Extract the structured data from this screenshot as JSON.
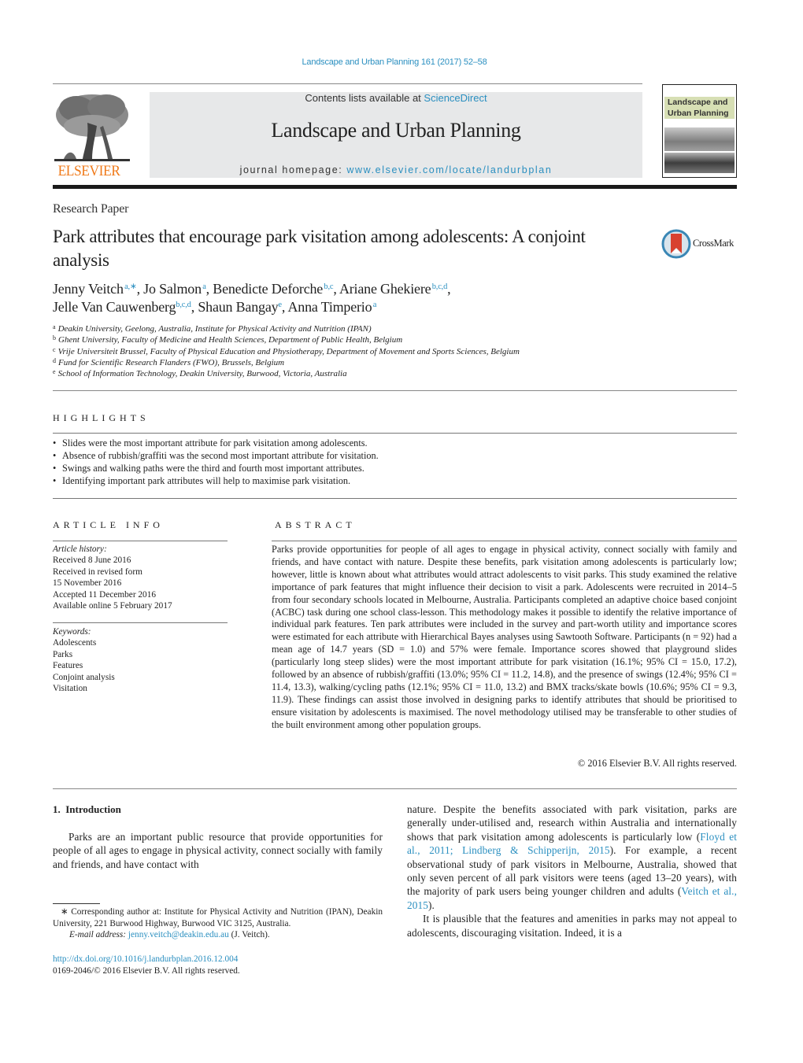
{
  "journal_ref": "Landscape and Urban Planning 161 (2017) 52–58",
  "masthead": {
    "publisher": "ELSEVIER",
    "contents_prefix": "Contents lists available at ",
    "contents_link": "ScienceDirect",
    "journal_title": "Landscape and Urban Planning",
    "homepage_prefix": "journal homepage: ",
    "homepage_url": "www.elsevier.com/locate/landurbplan",
    "cover_title": "Landscape and Urban Planning"
  },
  "article": {
    "type": "Research Paper",
    "title": "Park attributes that encourage park visitation among adolescents: A conjoint analysis",
    "crossmark_label": "CrossMark",
    "authors": [
      {
        "name": "Jenny Veitch",
        "sup": "a,∗",
        "sep": ", "
      },
      {
        "name": "Jo Salmon",
        "sup": "a",
        "sep": ", "
      },
      {
        "name": "Benedicte Deforche",
        "sup": "b,c",
        "sep": ", "
      },
      {
        "name": "Ariane Ghekiere",
        "sup": "b,c,d",
        "sep": ","
      },
      {
        "name": "Jelle Van Cauwenberg",
        "sup": "b,c,d",
        "sep": ", "
      },
      {
        "name": "Shaun Bangay",
        "sup": "e",
        "sep": ", "
      },
      {
        "name": "Anna Timperio",
        "sup": "a",
        "sep": ""
      }
    ],
    "affiliations": [
      {
        "key": "a",
        "text": "Deakin University, Geelong, Australia, Institute for Physical Activity and Nutrition (IPAN)"
      },
      {
        "key": "b",
        "text": "Ghent University, Faculty of Medicine and Health Sciences, Department of Public Health, Belgium"
      },
      {
        "key": "c",
        "text": "Vrije Universiteit Brussel, Faculty of Physical Education and Physiotherapy, Department of Movement and Sports Sciences, Belgium"
      },
      {
        "key": "d",
        "text": "Fund for Scientific Research Flanders (FWO), Brussels, Belgium"
      },
      {
        "key": "e",
        "text": "School of Information Technology, Deakin University, Burwood, Victoria, Australia"
      }
    ]
  },
  "highlights": {
    "heading": "HIGHLIGHTS",
    "items": [
      "Slides were the most important attribute for park visitation among adolescents.",
      "Absence of rubbish/graffiti was the second most important attribute for visitation.",
      "Swings and walking paths were the third and fourth most important attributes.",
      "Identifying important park attributes will help to maximise park visitation."
    ]
  },
  "article_info": {
    "heading": "ARTICLE INFO",
    "history_label": "Article history:",
    "history": [
      "Received 8 June 2016",
      "Received in revised form",
      "15 November 2016",
      "Accepted 11 December 2016",
      "Available online 5 February 2017"
    ],
    "keywords_label": "Keywords:",
    "keywords": [
      "Adolescents",
      "Parks",
      "Features",
      "Conjoint analysis",
      "Visitation"
    ]
  },
  "abstract": {
    "heading": "ABSTRACT",
    "text": "Parks provide opportunities for people of all ages to engage in physical activity, connect socially with family and friends, and have contact with nature. Despite these benefits, park visitation among ado­lescents is particularly low; however, little is known about what attributes would attract adolescents to visit parks. This study examined the relative importance of park features that might influence their decision to visit a park. Adolescents were recruited in 2014–5 from four secondary schools located in Melbourne, Australia. Participants completed an adaptive choice based conjoint (ACBC) task during one school class-lesson. This methodology makes it possible to identify the relative importance of individual park features. Ten park attributes were included in the survey and part-worth utility and importance scores were estimated for each attribute with Hierarchical Bayes analyses using Sawtooth Software. Par­ticipants (n = 92) had a mean age of 14.7 years (SD = 1.0) and 57% were female. Importance scores showed that playground slides (particularly long steep slides) were the most important attribute for park visita­tion (16.1%; 95% CI = 15.0, 17.2), followed by an absence of rubbish/graffiti (13.0%; 95% CI = 11.2, 14.8), and the presence of swings (12.4%; 95% CI = 11.4, 13.3), walking/cycling paths (12.1%; 95% CI = 11.0, 13.2) and BMX tracks/skate bowls (10.6%; 95% CI = 9.3, 11.9). These findings can assist those involved in designing parks to identify attributes that should be prioritised to ensure visitation by adolescents is maximised. The novel methodology utilised may be transferable to other studies of the built environment among other population groups.",
    "copyright": "© 2016 Elsevier B.V. All rights reserved."
  },
  "introduction": {
    "heading": "1.  Introduction",
    "col1_para1": "Parks are an important public resource that provide oppor­tunities for people of all ages to engage in physical activity, connect socially with family and friends, and have contact with",
    "col2_para1_a": "nature. Despite the benefits associated with park visitation, parks are generally under-utilised and, research within Australia and internationally shows that park visitation among adolescents is particularly low (",
    "col2_cite1": "Floyd et al., 2011; Lindberg & Schipperijn, 2015",
    "col2_para1_b": "). For example, a recent observational study of park visitors in Mel­bourne, Australia, showed that only seven percent of all park visitors were teens (aged 13–20 years), with the majority of park users being younger children and adults (",
    "col2_cite2": "Veitch et al., 2015",
    "col2_para1_c": ").",
    "col2_para2": "It is plausible that the features and amenities in parks may not appeal to adolescents, discouraging visitation. Indeed, it is a"
  },
  "footnotes": {
    "corresponding": "∗  Corresponding author at: Institute for Physical Activity and Nutrition (IPAN), Deakin University, 221 Burwood Highway, Burwood VIC 3125, Australia.",
    "email_label": "E-mail address: ",
    "email": "jenny.veitch@deakin.edu.au",
    "email_suffix": " (J. Veitch).",
    "doi": "http://dx.doi.org/10.1016/j.landurbplan.2016.12.004",
    "issn_line": "0169-2046/© 2016 Elsevier B.V. All rights reserved."
  },
  "colors": {
    "link": "#2a8fc0",
    "elsevier_orange": "#f07a1a",
    "masthead_bg": "#e7e8e9"
  }
}
